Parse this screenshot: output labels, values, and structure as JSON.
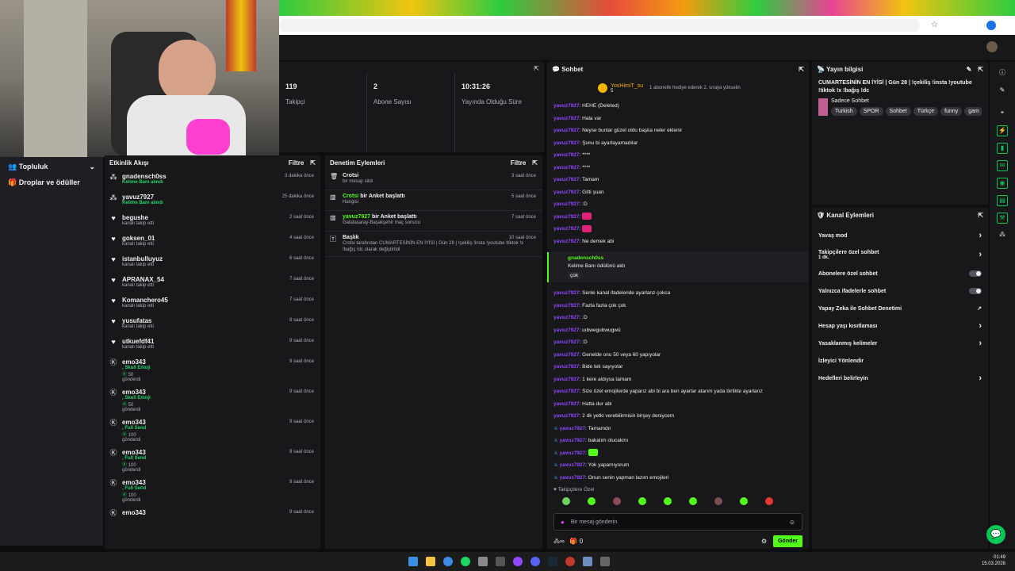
{
  "browser": {
    "tab_hint": "",
    "url": ""
  },
  "stats": [
    {
      "value": "119",
      "label": "Takipçi"
    },
    {
      "value": "2",
      "label": "Abone Sayısı"
    },
    {
      "value": "10:31:26",
      "label": "Yayında Olduğu Süre"
    }
  ],
  "sidebar": {
    "items": [
      {
        "label": "Topluluk"
      },
      {
        "label": "Droplar ve ödüller"
      }
    ]
  },
  "activity": {
    "title": "Etkinlik Akışı",
    "filter": "Filtre",
    "events": [
      {
        "name": "gnadensch0ss",
        "sub": "Kelime Banı alındı",
        "sub_green": "Kelime Banı",
        "time": "3 dakika önce",
        "icon": "points-icon"
      },
      {
        "name": "yavuz7927",
        "sub": "Kelime Banı alındı",
        "sub_green": "Kelime Banı",
        "time": "25 dakika önce",
        "icon": "points-icon"
      },
      {
        "name": "begushe",
        "sub": "kanalı takip etti",
        "time": "2 saat önce",
        "icon": "heart-icon"
      },
      {
        "name": "goksen_01",
        "sub": "kanalı takip etti",
        "time": "4 saat önce",
        "icon": "heart-icon"
      },
      {
        "name": "istanbulluyuz",
        "sub": "kanalı takip etti",
        "time": "6 saat önce",
        "icon": "heart-icon"
      },
      {
        "name": "APRANAX_54",
        "sub": "kanalı takip etti",
        "time": "7 saat önce",
        "icon": "heart-icon"
      },
      {
        "name": "Komanchero45",
        "sub": "kanalı takip etti",
        "time": "7 saat önce",
        "icon": "heart-icon"
      },
      {
        "name": "yusufatas",
        "sub": "kanalı takip etti",
        "time": "8 saat önce",
        "icon": "heart-icon"
      },
      {
        "name": "utkuefdf41",
        "sub": "kanalı takip etti",
        "time": "9 saat önce",
        "icon": "heart-icon"
      },
      {
        "name": "emo343",
        "sub": ", Skull Emoji",
        "amount": "50",
        "tail": "gönderdi",
        "time": "9 saat önce",
        "icon": "kick-icon"
      },
      {
        "name": "emo343",
        "sub": ", Skull Emoji",
        "amount": "50",
        "tail": "gönderdi",
        "time": "9 saat önce",
        "icon": "kick-icon"
      },
      {
        "name": "emo343",
        "sub": ", Full Send",
        "amount": "100",
        "tail": "gönderdi",
        "time": "9 saat önce",
        "icon": "kick-icon"
      },
      {
        "name": "emo343",
        "sub": ", Full Send",
        "amount": "100",
        "tail": "gönderdi",
        "time": "9 saat önce",
        "icon": "kick-icon"
      },
      {
        "name": "emo343",
        "sub": ", Full Send",
        "amount": "100",
        "tail": "gönderdi",
        "time": "9 saat önce",
        "icon": "kick-icon"
      },
      {
        "name": "emo343",
        "sub": "",
        "time": "9 saat önce",
        "icon": "kick-icon"
      }
    ]
  },
  "moderation": {
    "title": "Denetim Eylemleri",
    "filter": "Filtre",
    "actions": [
      {
        "name": "Crotsi",
        "sub": "bir mesajı sildi",
        "time": "3 saat önce",
        "icon": "trash-icon"
      },
      {
        "name": "Crotsi",
        "action": "bir Anket başlattı",
        "sub": "Hangisi",
        "time": "5 saat önce",
        "icon": "poll-icon"
      },
      {
        "name": "yavuz7927",
        "action": "bir Anket başlattı",
        "sub": "Galatasaray-Başakşehir maç sonucu",
        "time": "7 saat önce",
        "icon": "poll-icon"
      },
      {
        "name": "Başlık",
        "sub": "Crotsi tarafından CUMARTESİNİN EN İYİSİ | Gün 28 | !çekiliş !insta !youtube !tiktok !x !bağış !dc olarak değiştirildi",
        "time": "10 saat önce",
        "icon": "title-icon"
      }
    ]
  },
  "chat": {
    "title": "Sohbet",
    "pinned_user": "YosHimiT_su",
    "pinned_count": "5",
    "pinned_text": "1 abonelik hediye ederek 2. sıraya yükselin",
    "lines_top": [
      {
        "user": "yavuz7927",
        "text": "HEHE (Deleted)"
      },
      {
        "user": "yavuz7927",
        "text": "Hala var"
      },
      {
        "user": "yavuz7927",
        "text": "Neyse bunlar güzel oldu başka neler eklenir"
      },
      {
        "user": "yavuz7927",
        "text": "Şunu bi ayarlayamadılar"
      },
      {
        "user": "yavuz7927",
        "text": "****"
      },
      {
        "user": "yavuz7927",
        "text": "****"
      },
      {
        "user": "yavuz7927",
        "text": "Tamam"
      },
      {
        "user": "yavuz7927",
        "text": "Gitti şuan"
      },
      {
        "user": "yavuz7927",
        "text": ":D"
      },
      {
        "user": "yavuz7927",
        "text": ""
      },
      {
        "user": "yavuz7927",
        "text": ""
      },
      {
        "user": "yavuz7927",
        "text": "Ne demek abi"
      }
    ],
    "redeem": {
      "user": "gnadensch0ss",
      "text": "Kelime Banı ödülünü aldı",
      "word": "çok"
    },
    "lines_bottom": [
      {
        "user": "yavuz7927",
        "text": "Senle kanal ifadeleride ayarlanz çokca"
      },
      {
        "user": "yavuz7927",
        "text": "Fazla fazla çok çok"
      },
      {
        "user": "yavuz7927",
        "text": ":D"
      },
      {
        "user": "yavuz7927",
        "text": "uıbwegubwugwü"
      },
      {
        "user": "yavuz7927",
        "text": ":D"
      },
      {
        "user": "yavuz7927",
        "text": "Genelde onu 50 veya 60 yapıyolar"
      },
      {
        "user": "yavuz7927",
        "text": "Bide tek sayıyolar"
      },
      {
        "user": "yavuz7927",
        "text": "1 kere aldıysa tamam"
      },
      {
        "user": "yavuz7927",
        "text": "Size özel emojilerde yaparız abi bi ara ben ayarlar atarım yada birlikte ayarlarız"
      },
      {
        "user": "yavuz7927",
        "text": "Hatta dur abi"
      },
      {
        "user": "yavuz7927",
        "text": "2 dk yetki verebilirmisin birşey deniycem"
      },
      {
        "user": "yavuz7927",
        "text": "Tamamdır",
        "mod": true
      },
      {
        "user": "yavuz7927",
        "text": "bakalım olucakmı",
        "mod": true
      },
      {
        "user": "yavuz7927",
        "text": "",
        "mod": true
      },
      {
        "user": "yavuz7927",
        "text": "Yok yapamıyorum",
        "mod": true
      },
      {
        "user": "yavuz7927",
        "text": "Onun senin yapman lazım emojileri",
        "mod": true
      }
    ],
    "followers_only": "Takipçilere Özel",
    "placeholder": "Bir mesaj gönderin",
    "points": "0",
    "send": "Gönder"
  },
  "stream_info": {
    "header": "Yayın bilgisi",
    "title": "CUMARTESİNİN EN İYİSİ | Gün 28 | !çekiliş !insta !youtube !tiktok !x !bağış !dc",
    "category": "Sadece Sohbet",
    "tags": [
      "Turkish",
      "SPOR",
      "Sohbet",
      "Türkçe",
      "funny",
      "gam"
    ]
  },
  "channel": {
    "header": "Kanal Eylemleri",
    "rows": [
      {
        "label": "Yavaş mod",
        "kind": "arrow"
      },
      {
        "label": "Takipçilere özel sohbet",
        "sub": "1 dk.",
        "kind": "arrow"
      },
      {
        "label": "Abonelere özel sohbet",
        "kind": "toggle"
      },
      {
        "label": "Yalnızca ifadelerle sohbet",
        "kind": "toggle"
      },
      {
        "label": "Yapay Zeka ile Sohbet Denetimi",
        "kind": "link"
      },
      {
        "label": "Hesap yaşı kısıtlaması",
        "kind": "arrow"
      },
      {
        "label": "Yasaklanmış kelimeler",
        "kind": "arrow"
      },
      {
        "label": "İzleyici Yönlendir",
        "kind": "none"
      },
      {
        "label": "Hedefleri belirleyin",
        "kind": "arrow"
      }
    ]
  },
  "taskbar": {
    "time": "01:49",
    "date": "15.03.2026"
  },
  "colors": {
    "brand": "#53fc18",
    "purple": "#9147ff",
    "bg": "#0e0e10",
    "panel": "#18181b"
  }
}
